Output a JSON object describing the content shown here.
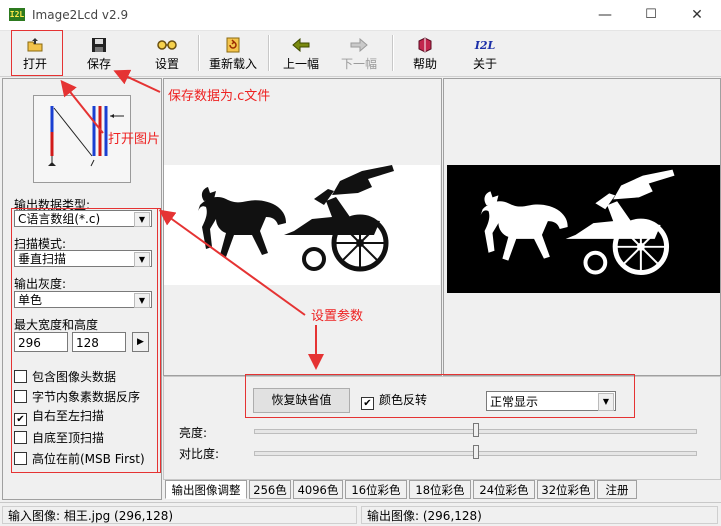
{
  "window": {
    "title": "Image2Lcd v2.9",
    "logo": "I2L",
    "minimize": "—",
    "maximize": "☐",
    "close": "✕"
  },
  "toolbar": {
    "open": "打开",
    "save": "保存",
    "settings": "设置",
    "reload": "重新载入",
    "prev": "上一幅",
    "next": "下一幅",
    "help": "帮助",
    "about": "关于"
  },
  "left": {
    "output_type_label": "输出数据类型:",
    "output_type_value": "C语言数组(*.c)",
    "scan_mode_label": "扫描模式:",
    "scan_mode_value": "垂直扫描",
    "gray_label": "输出灰度:",
    "gray_value": "单色",
    "max_size_label": "最大宽度和高度",
    "max_width": "296",
    "max_height": "128",
    "checks": [
      {
        "label": "包含图像头数据",
        "checked": false
      },
      {
        "label": "字节内象素数据反序",
        "checked": false
      },
      {
        "label": "自右至左扫描",
        "checked": true
      },
      {
        "label": "自底至顶扫描",
        "checked": false
      },
      {
        "label": "高位在前(MSB First)",
        "checked": false
      }
    ]
  },
  "bottom": {
    "restore_button": "恢复缺省值",
    "invert_label": "颜色反转",
    "invert_checked": true,
    "display_mode": "正常显示",
    "brightness_label": "亮度:",
    "contrast_label": "对比度:",
    "brightness_level": 0.5,
    "contrast_level": 0.5
  },
  "tabs": [
    "输出图像调整",
    "256色",
    "4096色",
    "16位彩色",
    "18位彩色",
    "24位彩色",
    "32位彩色",
    "注册"
  ],
  "status": {
    "input": "输入图像: 相王.jpg (296,128)",
    "output": "输出图像: (296,128)"
  },
  "annotations": {
    "save_note": "保存数据为.c文件",
    "open_note": "打开图片",
    "params_note": "设置参数"
  },
  "colors": {
    "annotation": "#e53333",
    "logo_bg": "#2d7a1f"
  }
}
